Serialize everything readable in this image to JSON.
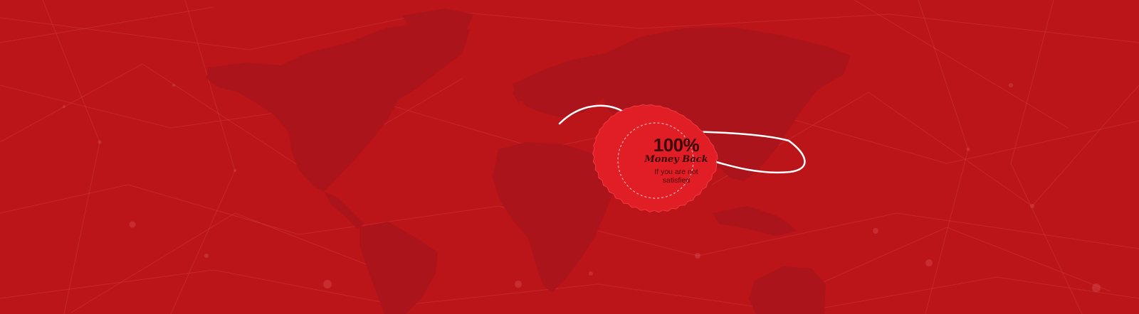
{
  "badge": {
    "percent": "100%",
    "title": "Money Back",
    "subtitle_line1": "If you are not",
    "subtitle_line2": "satisfied",
    "icon": "seal-icon"
  },
  "colors": {
    "background": "#bb151a",
    "map": "#ab141a",
    "network_lines": "#d44a4f",
    "seal": "#e11d26",
    "seal_text": "#3a0608",
    "string": "#ffffff"
  },
  "decor": {
    "map_icon": "world-map-icon",
    "network_icon": "network-mesh-icon",
    "string_icon": "tag-string-icon"
  }
}
